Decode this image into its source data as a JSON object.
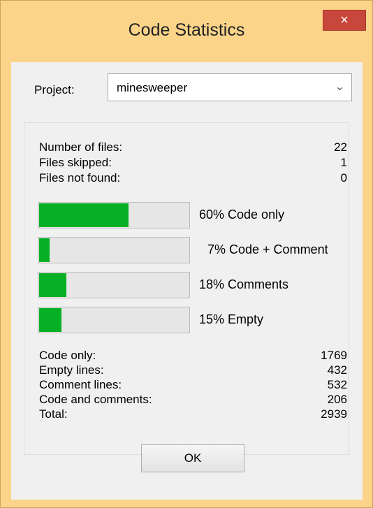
{
  "window": {
    "title": "Code Statistics",
    "close_glyph": "×"
  },
  "project": {
    "label": "Project:",
    "selected": "minesweeper",
    "arrow_glyph": "⌄"
  },
  "file_stats": [
    {
      "label": "Number of files:",
      "value": "22"
    },
    {
      "label": "Files skipped:",
      "value": "1"
    },
    {
      "label": "Files not found:",
      "value": "0"
    }
  ],
  "bars": [
    {
      "label": "60% Code only",
      "percent": 60
    },
    {
      "label": "7% Code + Comment",
      "percent": 7
    },
    {
      "label": "18% Comments",
      "percent": 18
    },
    {
      "label": "15% Empty",
      "percent": 15
    }
  ],
  "line_stats": [
    {
      "label": "Code only:",
      "value": "1769"
    },
    {
      "label": "Empty lines:",
      "value": "432"
    },
    {
      "label": "Comment lines:",
      "value": "532"
    },
    {
      "label": "Code and comments:",
      "value": "206"
    },
    {
      "label": "Total:",
      "value": "2939"
    }
  ],
  "ok_label": "OK",
  "colors": {
    "bar_fill": "#06b025",
    "title_bar": "#fbd48a",
    "close_button": "#c8473c"
  }
}
